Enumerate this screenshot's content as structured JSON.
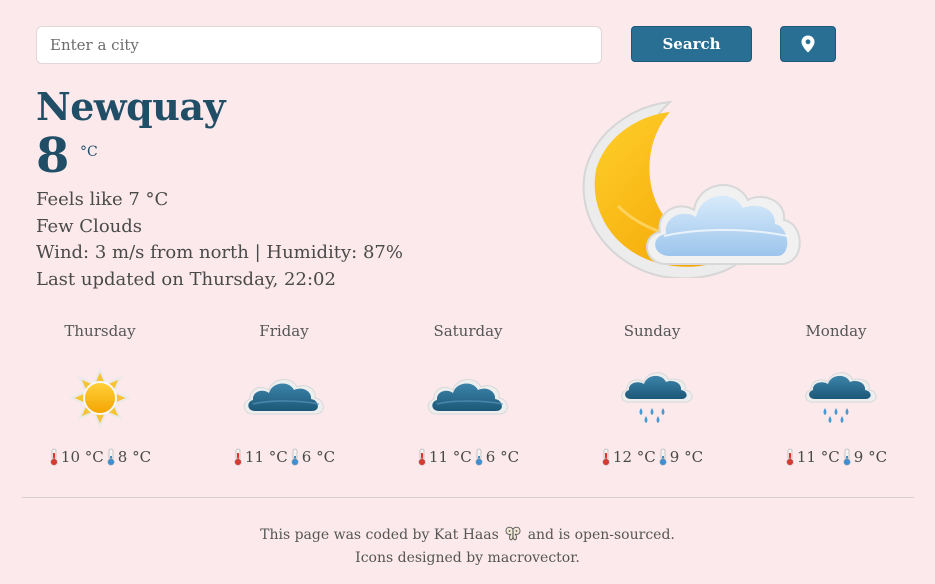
{
  "search": {
    "placeholder": "Enter a city",
    "value": "",
    "button_label": "Search",
    "location_icon": "map-pin-icon"
  },
  "current": {
    "city": "Newquay",
    "temperature": "8",
    "unit": "°C",
    "feels_like": "Feels like 7 °C",
    "description": "Few Clouds",
    "wind_humidity": "Wind: 3 m/s from north | Humidity: 87%",
    "last_updated": "Last updated on Thursday, 22:02",
    "icon": "moon-cloud-icon"
  },
  "forecast": [
    {
      "day": "Thursday",
      "icon": "sun-icon",
      "max": "10 °C",
      "min": "8 °C"
    },
    {
      "day": "Friday",
      "icon": "cloud-icon",
      "max": "11 °C",
      "min": "6 °C"
    },
    {
      "day": "Saturday",
      "icon": "cloud-icon",
      "max": "11 °C",
      "min": "6 °C"
    },
    {
      "day": "Sunday",
      "icon": "rain-cloud-icon",
      "max": "12 °C",
      "min": "9 °C"
    },
    {
      "day": "Monday",
      "icon": "rain-cloud-icon",
      "max": "11 °C",
      "min": "9 °C"
    }
  ],
  "footer": {
    "line1_prefix": "This page was coded by",
    "author": "Kat Haas",
    "line1_middle": "and is",
    "opensource_link": "open-sourced",
    "line1_suffix": ".",
    "line2_prefix": "Icons designed by",
    "icons_link": "macrovector",
    "line2_suffix": "."
  },
  "colors": {
    "background": "#fbe9ec",
    "accent": "#296f94",
    "heading": "#1f4e66"
  }
}
